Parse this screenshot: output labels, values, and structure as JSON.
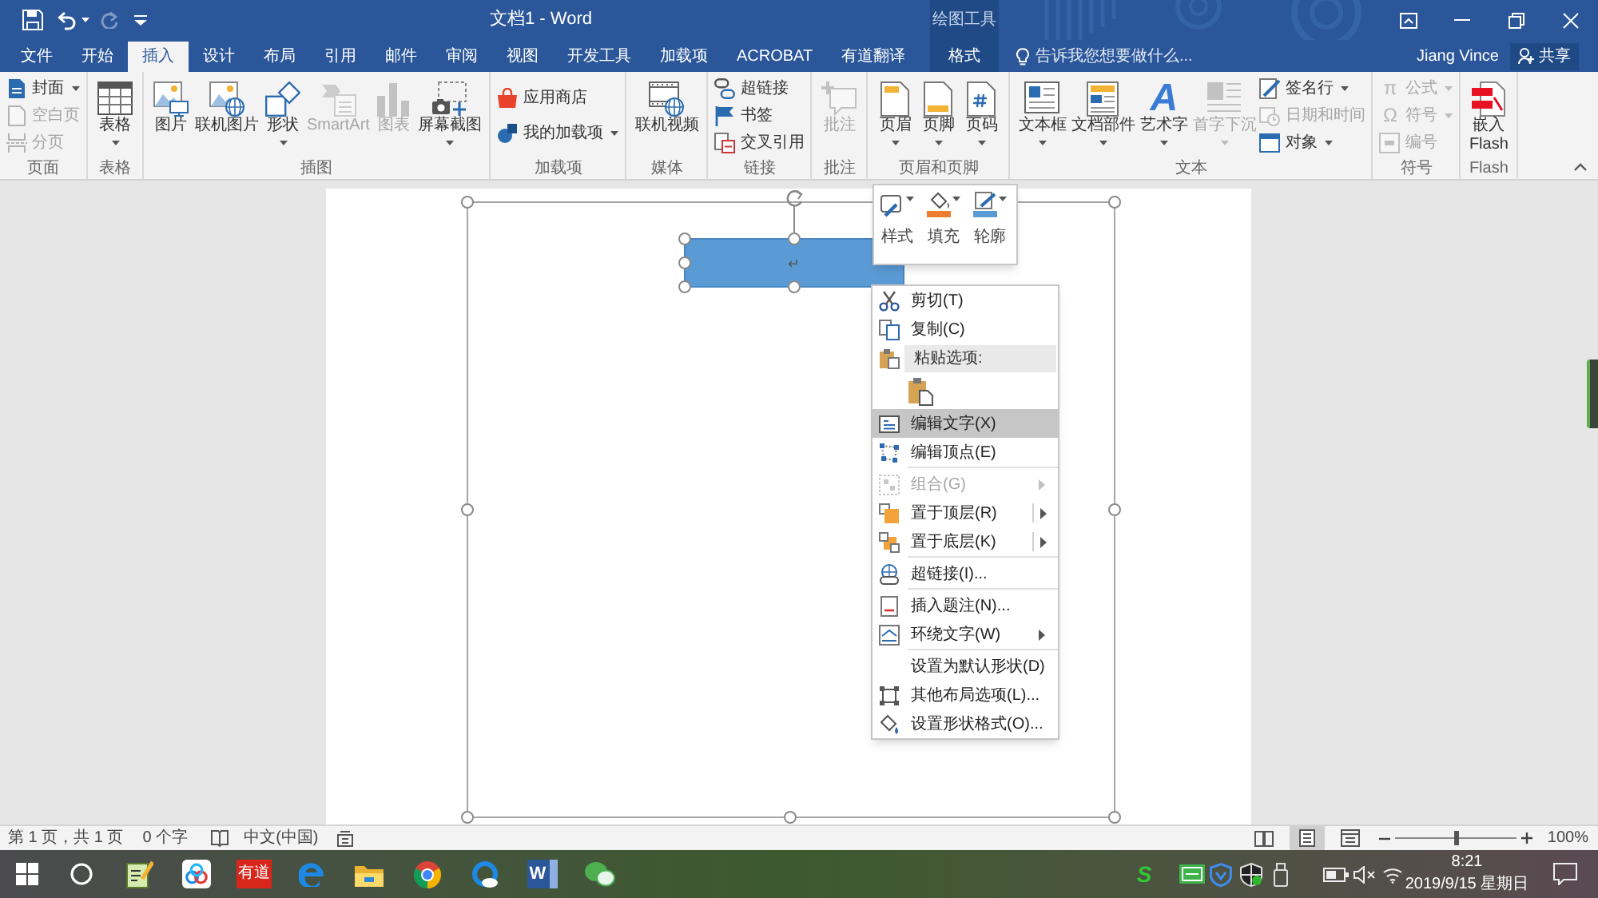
{
  "window": {
    "title": "文档1 - Word",
    "contextual_group": "绘图工具"
  },
  "quick_access": [
    {
      "kind": "save",
      "disabled": false
    },
    {
      "kind": "undo",
      "disabled": false
    },
    {
      "kind": "redo",
      "disabled": true
    },
    {
      "kind": "customize",
      "disabled": false
    }
  ],
  "tabs": [
    {
      "label": "文件",
      "kind": "standard",
      "selected": false
    },
    {
      "label": "开始",
      "kind": "standard",
      "selected": false
    },
    {
      "label": "插入",
      "kind": "standard",
      "selected": true
    },
    {
      "label": "设计",
      "kind": "standard",
      "selected": false
    },
    {
      "label": "布局",
      "kind": "standard",
      "selected": false
    },
    {
      "label": "引用",
      "kind": "standard",
      "selected": false
    },
    {
      "label": "邮件",
      "kind": "standard",
      "selected": false
    },
    {
      "label": "审阅",
      "kind": "standard",
      "selected": false
    },
    {
      "label": "视图",
      "kind": "standard",
      "selected": false
    },
    {
      "label": "开发工具",
      "kind": "standard",
      "selected": false
    },
    {
      "label": "加载项",
      "kind": "standard",
      "selected": false
    },
    {
      "label": "ACROBAT",
      "kind": "standard",
      "selected": false
    },
    {
      "label": "有道翻译",
      "kind": "standard",
      "selected": false
    },
    {
      "label": "格式",
      "kind": "contextual",
      "selected": false
    }
  ],
  "tell_me": {
    "placeholder": "告诉我您想要做什么..."
  },
  "account": {
    "user": "Jiang Vince",
    "share": "共享"
  },
  "ribbon": {
    "groups": [
      {
        "label": "页面",
        "items": [
          {
            "kind": "small",
            "label": "封面",
            "dropdown": true,
            "disabled": false
          },
          {
            "kind": "small",
            "label": "空白页",
            "dropdown": false,
            "disabled": true
          },
          {
            "kind": "small",
            "label": "分页",
            "dropdown": false,
            "disabled": true
          }
        ]
      },
      {
        "label": "表格",
        "items": [
          {
            "kind": "large",
            "label": "表格",
            "dropdown": true,
            "disabled": false
          }
        ]
      },
      {
        "label": "插图",
        "items": [
          {
            "kind": "large",
            "label": "图片",
            "dropdown": false,
            "disabled": false
          },
          {
            "kind": "large",
            "label": "联机图片",
            "dropdown": false,
            "disabled": false
          },
          {
            "kind": "large",
            "label": "形状",
            "dropdown": true,
            "disabled": false
          },
          {
            "kind": "large",
            "label": "SmartArt",
            "dropdown": false,
            "disabled": true
          },
          {
            "kind": "large",
            "label": "图表",
            "dropdown": false,
            "disabled": true
          },
          {
            "kind": "large",
            "label": "屏幕截图",
            "dropdown": true,
            "disabled": false
          }
        ]
      },
      {
        "label": "加载项",
        "items": [
          {
            "kind": "small",
            "label": "应用商店",
            "dropdown": false,
            "disabled": false
          },
          {
            "kind": "small",
            "label": "我的加载项",
            "dropdown": true,
            "disabled": false
          }
        ]
      },
      {
        "label": "媒体",
        "items": [
          {
            "kind": "large",
            "label": "联机视频",
            "dropdown": false,
            "disabled": false
          }
        ]
      },
      {
        "label": "链接",
        "items": [
          {
            "kind": "small",
            "label": "超链接",
            "dropdown": false,
            "disabled": false
          },
          {
            "kind": "small",
            "label": "书签",
            "dropdown": false,
            "disabled": false
          },
          {
            "kind": "small",
            "label": "交叉引用",
            "dropdown": false,
            "disabled": false
          }
        ]
      },
      {
        "label": "批注",
        "items": [
          {
            "kind": "large",
            "label": "批注",
            "dropdown": false,
            "disabled": true
          }
        ]
      },
      {
        "label": "页眉和页脚",
        "items": [
          {
            "kind": "large",
            "label": "页眉",
            "dropdown": true,
            "disabled": false
          },
          {
            "kind": "large",
            "label": "页脚",
            "dropdown": true,
            "disabled": false
          },
          {
            "kind": "large",
            "label": "页码",
            "dropdown": true,
            "disabled": false
          }
        ]
      },
      {
        "label": "文本",
        "items": [
          {
            "kind": "large",
            "label": "文本框",
            "dropdown": true,
            "disabled": false
          },
          {
            "kind": "large",
            "label": "文档部件",
            "dropdown": true,
            "disabled": false
          },
          {
            "kind": "large",
            "label": "艺术字",
            "glyph": "A",
            "dropdown": true,
            "disabled": false
          },
          {
            "kind": "large",
            "label": "首字下沉",
            "dropdown": true,
            "disabled": true
          },
          {
            "kind": "small",
            "label": "签名行",
            "dropdown": true,
            "disabled": false
          },
          {
            "kind": "small",
            "label": "日期和时间",
            "dropdown": false,
            "disabled": true
          },
          {
            "kind": "small",
            "label": "对象",
            "dropdown": true,
            "disabled": false
          }
        ]
      },
      {
        "label": "符号",
        "items": [
          {
            "kind": "small",
            "label": "公式",
            "glyph": "π",
            "dropdown": true,
            "disabled": true
          },
          {
            "kind": "small",
            "label": "符号",
            "glyph": "Ω",
            "dropdown": true,
            "disabled": true
          },
          {
            "kind": "small",
            "label": "编号",
            "dropdown": false,
            "disabled": true
          }
        ]
      },
      {
        "label": "Flash",
        "items": [
          {
            "kind": "large",
            "label": "嵌入 Flash",
            "dropdown": false,
            "disabled": false
          }
        ]
      }
    ]
  },
  "document": {
    "paragraph_mark": "↵"
  },
  "mini_toolbar": [
    {
      "label": "样式"
    },
    {
      "label": "填充",
      "color": "#ed7d31"
    },
    {
      "label": "轮廓",
      "color": "#5b9bd5"
    }
  ],
  "context_menu": {
    "sections": [
      [
        {
          "kind": "command",
          "label": "剪切(T)",
          "disabled": false,
          "selected": false,
          "submenu": false,
          "split": false
        },
        {
          "kind": "command",
          "label": "复制(C)",
          "disabled": false,
          "selected": false,
          "submenu": false,
          "split": false
        },
        {
          "kind": "header",
          "label": "粘贴选项:"
        },
        {
          "kind": "paste_option",
          "selected": false
        },
        {
          "kind": "command",
          "label": "编辑文字(X)",
          "disabled": false,
          "selected": true,
          "submenu": false,
          "split": false
        },
        {
          "kind": "command",
          "label": "编辑顶点(E)",
          "disabled": false,
          "selected": false,
          "submenu": false,
          "split": false
        }
      ],
      [
        {
          "kind": "command",
          "label": "组合(G)",
          "disabled": true,
          "selected": false,
          "submenu": true,
          "split": false
        },
        {
          "kind": "command",
          "label": "置于顶层(R)",
          "disabled": false,
          "selected": false,
          "submenu": true,
          "split": true
        },
        {
          "kind": "command",
          "label": "置于底层(K)",
          "disabled": false,
          "selected": false,
          "submenu": true,
          "split": true
        }
      ],
      [
        {
          "kind": "command",
          "label": "超链接(I)...",
          "disabled": false,
          "selected": false,
          "submenu": false,
          "split": false
        }
      ],
      [
        {
          "kind": "command",
          "label": "插入题注(N)...",
          "disabled": false,
          "selected": false,
          "submenu": false,
          "split": false
        },
        {
          "kind": "command",
          "label": "环绕文字(W)",
          "disabled": false,
          "selected": false,
          "submenu": true,
          "split": false
        }
      ],
      [
        {
          "kind": "command",
          "label": "设置为默认形状(D)",
          "disabled": false,
          "selected": false,
          "submenu": false,
          "split": false
        },
        {
          "kind": "command",
          "label": "其他布局选项(L)...",
          "disabled": false,
          "selected": false,
          "submenu": false,
          "split": false
        },
        {
          "kind": "command",
          "label": "设置形状格式(O)...",
          "disabled": false,
          "selected": false,
          "submenu": false,
          "split": false
        }
      ]
    ]
  },
  "status_bar": {
    "page": "第 1 页，共 1 页",
    "words": "0 个字",
    "language": "中文(中国)",
    "views": [
      {
        "kind": "read",
        "selected": false
      },
      {
        "kind": "print",
        "selected": true
      },
      {
        "kind": "web",
        "selected": false
      }
    ],
    "zoom_slider": {
      "level": 0.5
    },
    "zoom": "100%"
  },
  "taskbar": {
    "apps": [
      {
        "kind": "start"
      },
      {
        "kind": "search"
      },
      {
        "kind": "notes"
      },
      {
        "kind": "rings"
      },
      {
        "kind": "dictionary",
        "label": "有道"
      },
      {
        "kind": "edge"
      },
      {
        "kind": "folder"
      },
      {
        "kind": "chrome"
      },
      {
        "kind": "ring_browser"
      },
      {
        "kind": "word",
        "label": "W"
      },
      {
        "kind": "chat"
      }
    ],
    "tray": [
      {
        "kind": "ime",
        "label": "S"
      },
      {
        "kind": "app"
      },
      {
        "kind": "shield"
      },
      {
        "kind": "defender"
      },
      {
        "kind": "usb"
      },
      {
        "kind": "battery"
      },
      {
        "kind": "volume_muted"
      },
      {
        "kind": "wifi"
      }
    ],
    "time": "8:21",
    "date": "2019/9/15 星期日"
  }
}
